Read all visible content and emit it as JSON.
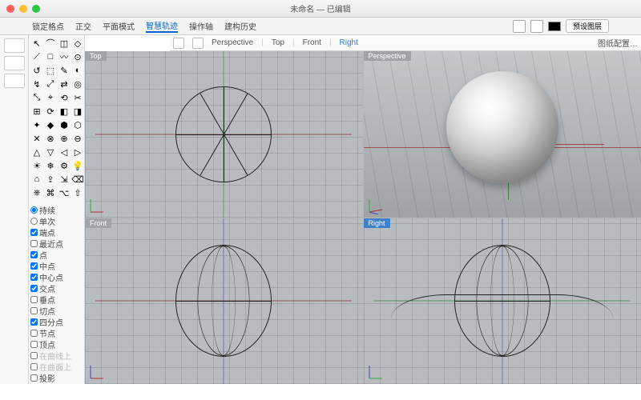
{
  "window": {
    "title": "未命名 — 已编辑"
  },
  "menubar": {
    "items": [
      "锁定格点",
      "正交",
      "平面模式",
      "智慧轨迹",
      "操作轴",
      "建构历史"
    ],
    "active_index": 3,
    "layer_button": "预设图层"
  },
  "viewrow": {
    "items": [
      "Perspective",
      "Top",
      "Front",
      "Right"
    ],
    "active_index": 3,
    "config_button": "图纸配置…"
  },
  "viewports": {
    "top": "Top",
    "persp": "Perspective",
    "front": "Front",
    "right": "Right"
  },
  "osnap": {
    "items": [
      {
        "label": "持续",
        "checked": true,
        "type": "radio"
      },
      {
        "label": "单次",
        "checked": false,
        "type": "radio"
      },
      {
        "label": "端点",
        "checked": true
      },
      {
        "label": "最近点",
        "checked": false
      },
      {
        "label": "点",
        "checked": true
      },
      {
        "label": "中点",
        "checked": true
      },
      {
        "label": "中心点",
        "checked": true
      },
      {
        "label": "交点",
        "checked": true
      },
      {
        "label": "垂点",
        "checked": false
      },
      {
        "label": "切点",
        "checked": false
      },
      {
        "label": "四分点",
        "checked": true
      },
      {
        "label": "节点",
        "checked": false
      },
      {
        "label": "顶点",
        "checked": false
      },
      {
        "label": "在曲线上",
        "checked": false,
        "dim": true
      },
      {
        "label": "在曲面上",
        "checked": false,
        "dim": true
      },
      {
        "label": "投影",
        "checked": false
      }
    ]
  },
  "toolpalette": {
    "glyphs": [
      "↖",
      "⌒",
      "◫",
      "◇",
      "⟋",
      "□",
      "〰",
      "⊙",
      "↺",
      "⬚",
      "✎",
      "◐",
      "↯",
      "⤢",
      "⇄",
      "◎",
      "⤡",
      "⌖",
      "⟲",
      "✂",
      "⊞",
      "⟳",
      "◧",
      "◨",
      "✦",
      "◆",
      "⬢",
      "⬡",
      "✕",
      "⊗",
      "⊕",
      "⊖",
      "△",
      "▽",
      "◁",
      "▷",
      "☀",
      "❄",
      "⚙",
      "💡",
      "⌂",
      "⇪",
      "⇲",
      "⌫",
      "⎈",
      "⌘",
      "⌥",
      "⇧"
    ]
  }
}
